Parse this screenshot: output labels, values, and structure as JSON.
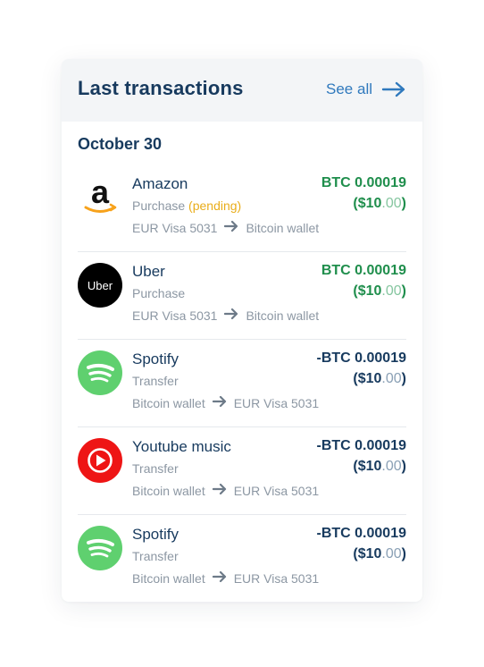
{
  "header": {
    "title": "Last transactions",
    "see_all": "See all"
  },
  "date_group": "October 30",
  "transactions": [
    {
      "merchant": "Amazon",
      "type": "Purchase",
      "status": "(pending)",
      "from": "EUR Visa 5031",
      "to": "Bitcoin wallet",
      "amount": "BTC 0.00019",
      "fiat_open": "($10",
      "fiat_cents": ".00",
      "fiat_close": ")",
      "icon": "amazon-logo"
    },
    {
      "merchant": "Uber",
      "type": "Purchase",
      "from": "EUR Visa 5031",
      "to": "Bitcoin wallet",
      "amount": "BTC 0.00019",
      "fiat_open": "($10",
      "fiat_cents": ".00",
      "fiat_close": ")",
      "icon": "uber-logo",
      "logo_text": "Uber"
    },
    {
      "merchant": "Spotify",
      "type": "Transfer",
      "from": "Bitcoin wallet",
      "to": "EUR Visa 5031",
      "amount": "-BTC 0.00019",
      "fiat_open": "($10",
      "fiat_cents": ".00",
      "fiat_close": ")",
      "icon": "spotify-logo"
    },
    {
      "merchant": "Youtube music",
      "type": "Transfer",
      "from": "Bitcoin wallet",
      "to": "EUR Visa 5031",
      "amount": "-BTC 0.00019",
      "fiat_open": "($10",
      "fiat_cents": ".00",
      "fiat_close": ")",
      "icon": "youtube-music-logo"
    },
    {
      "merchant": "Spotify",
      "type": "Transfer",
      "from": "Bitcoin wallet",
      "to": "EUR Visa 5031",
      "amount": "-BTC 0.00019",
      "fiat_open": "($10",
      "fiat_cents": ".00",
      "fiat_close": ")",
      "icon": "spotify-logo"
    }
  ],
  "colors": {
    "title": "#173a5e",
    "link": "#2f79bd",
    "positive": "#1f8e4c",
    "pending": "#e9ad1a",
    "muted": "#8c97a3",
    "spotify": "#5fd06f",
    "youtube": "#ee1515",
    "amazon_smile": "#f7a21b"
  }
}
